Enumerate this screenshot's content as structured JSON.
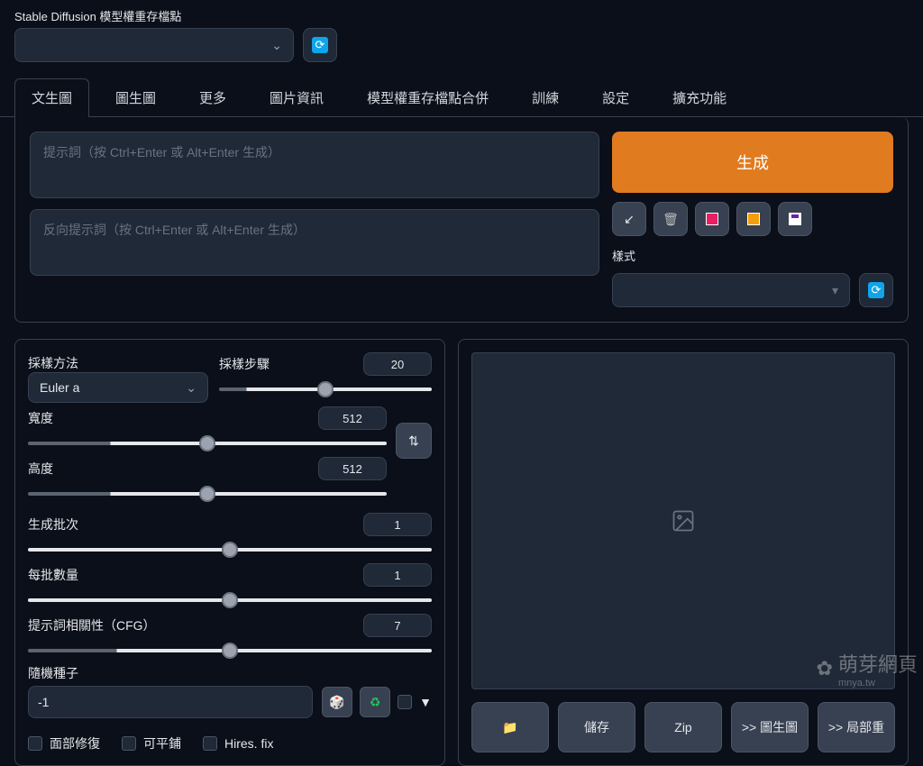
{
  "header": {
    "checkpoint_label": "Stable Diffusion 模型權重存檔點"
  },
  "tabs": [
    "文生圖",
    "圖生圖",
    "更多",
    "圖片資訊",
    "模型權重存檔點合併",
    "訓練",
    "設定",
    "擴充功能"
  ],
  "prompt": {
    "placeholder": "提示詞（按 Ctrl+Enter 或 Alt+Enter 生成）",
    "neg_placeholder": "反向提示詞（按 Ctrl+Enter 或 Alt+Enter 生成）"
  },
  "generate": {
    "label": "生成",
    "style_label": "樣式"
  },
  "params": {
    "sampler_label": "採樣方法",
    "sampler_value": "Euler a",
    "steps_label": "採樣步驟",
    "steps_value": "20",
    "width_label": "寬度",
    "width_value": "512",
    "height_label": "高度",
    "height_value": "512",
    "batch_count_label": "生成批次",
    "batch_count_value": "1",
    "batch_size_label": "每批數量",
    "batch_size_value": "1",
    "cfg_label": "提示詞相關性（CFG）",
    "cfg_value": "7",
    "seed_label": "隨機種子",
    "seed_value": "-1"
  },
  "checks": {
    "face": "面部修復",
    "tile": "可平鋪",
    "hires": "Hires. fix"
  },
  "outputs": {
    "folder": "",
    "save": "儲存",
    "zip": "Zip",
    "to_img2img": ">> 圖生圖",
    "to_inpaint": ">> 局部重"
  },
  "watermark": {
    "main": "萌芽網頁",
    "sub": "mnya.tw"
  }
}
